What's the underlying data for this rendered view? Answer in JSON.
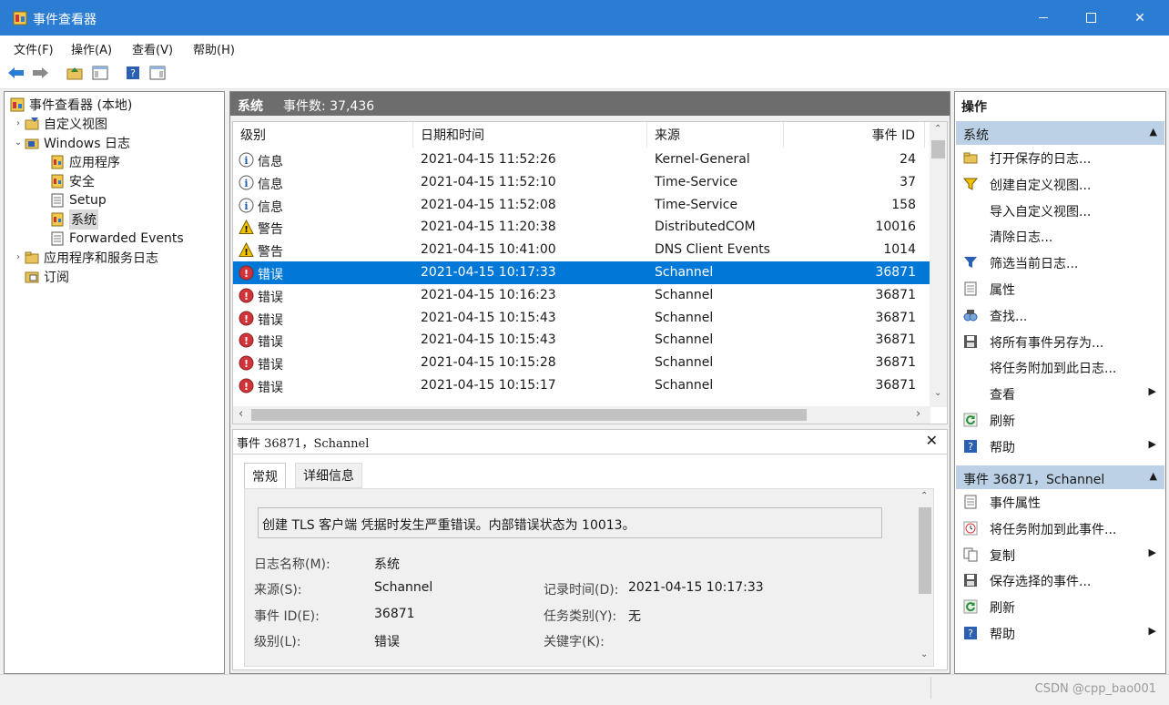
{
  "window": {
    "title": "事件查看器",
    "minimize": "—",
    "close": "✕"
  },
  "menu": [
    "文件(F)",
    "操作(A)",
    "查看(V)",
    "帮助(H)"
  ],
  "tree": {
    "root": "事件查看器 (本地)",
    "custom_views": "自定义视图",
    "windows_logs": "Windows 日志",
    "application": "应用程序",
    "security": "安全",
    "setup": "Setup",
    "system": "系统",
    "forwarded": "Forwarded Events",
    "app_service_logs": "应用程序和服务日志",
    "subscriptions": "订阅"
  },
  "center": {
    "title": "系统",
    "count": "事件数: 37,436",
    "columns": {
      "level": "级别",
      "datetime": "日期和时间",
      "source": "来源",
      "event_id": "事件 ID"
    },
    "rows": [
      {
        "level": "信息",
        "type": "info",
        "datetime": "2021-04-15 11:52:26",
        "source": "Kernel-General",
        "id": "24"
      },
      {
        "level": "信息",
        "type": "info",
        "datetime": "2021-04-15 11:52:10",
        "source": "Time-Service",
        "id": "37"
      },
      {
        "level": "信息",
        "type": "info",
        "datetime": "2021-04-15 11:52:08",
        "source": "Time-Service",
        "id": "158"
      },
      {
        "level": "警告",
        "type": "warn",
        "datetime": "2021-04-15 11:20:38",
        "source": "DistributedCOM",
        "id": "10016"
      },
      {
        "level": "警告",
        "type": "warn",
        "datetime": "2021-04-15 10:41:00",
        "source": "DNS Client Events",
        "id": "1014"
      },
      {
        "level": "错误",
        "type": "error",
        "datetime": "2021-04-15 10:17:33",
        "source": "Schannel",
        "id": "36871",
        "selected": true
      },
      {
        "level": "错误",
        "type": "error",
        "datetime": "2021-04-15 10:16:23",
        "source": "Schannel",
        "id": "36871"
      },
      {
        "level": "错误",
        "type": "error",
        "datetime": "2021-04-15 10:15:43",
        "source": "Schannel",
        "id": "36871"
      },
      {
        "level": "错误",
        "type": "error",
        "datetime": "2021-04-15 10:15:43",
        "source": "Schannel",
        "id": "36871"
      },
      {
        "level": "错误",
        "type": "error",
        "datetime": "2021-04-15 10:15:28",
        "source": "Schannel",
        "id": "36871"
      },
      {
        "level": "错误",
        "type": "error",
        "datetime": "2021-04-15 10:15:17",
        "source": "Schannel",
        "id": "36871"
      }
    ]
  },
  "detail": {
    "title": "事件 36871，Schannel",
    "close": "✕",
    "tabs": {
      "general": "常规",
      "details": "详细信息"
    },
    "message": "创建 TLS 客户端 凭据时发生严重错误。内部错误状态为 10013。",
    "fields": {
      "log_name_label": "日志名称(M):",
      "log_name": "系统",
      "source_label": "来源(S):",
      "source": "Schannel",
      "logged_label": "记录时间(D):",
      "logged": "2021-04-15 10:17:33",
      "event_id_label": "事件 ID(E):",
      "event_id": "36871",
      "task_label": "任务类别(Y):",
      "task": "无",
      "level_label": "级别(L):",
      "level": "错误",
      "keywords_label": "关键字(K):"
    }
  },
  "actions": {
    "header": "操作",
    "section1": "系统",
    "items1": [
      "打开保存的日志...",
      "创建自定义视图...",
      "导入自定义视图...",
      "清除日志...",
      "筛选当前日志...",
      "属性",
      "查找...",
      "将所有事件另存为...",
      "将任务附加到此日志...",
      "查看",
      "刷新",
      "帮助"
    ],
    "section2": "事件 36871，Schannel",
    "items2": [
      "事件属性",
      "将任务附加到此事件...",
      "复制",
      "保存选择的事件...",
      "刷新",
      "帮助"
    ]
  },
  "statusbar": {
    "watermark": "CSDN @cpp_bao001"
  },
  "colors": {
    "titlebar": "#2b7cd3",
    "selection": "#0078d7",
    "section": "#bcd1e6",
    "error": "#d13438",
    "warning": "#f2c200",
    "info": "#1f5ea8"
  }
}
